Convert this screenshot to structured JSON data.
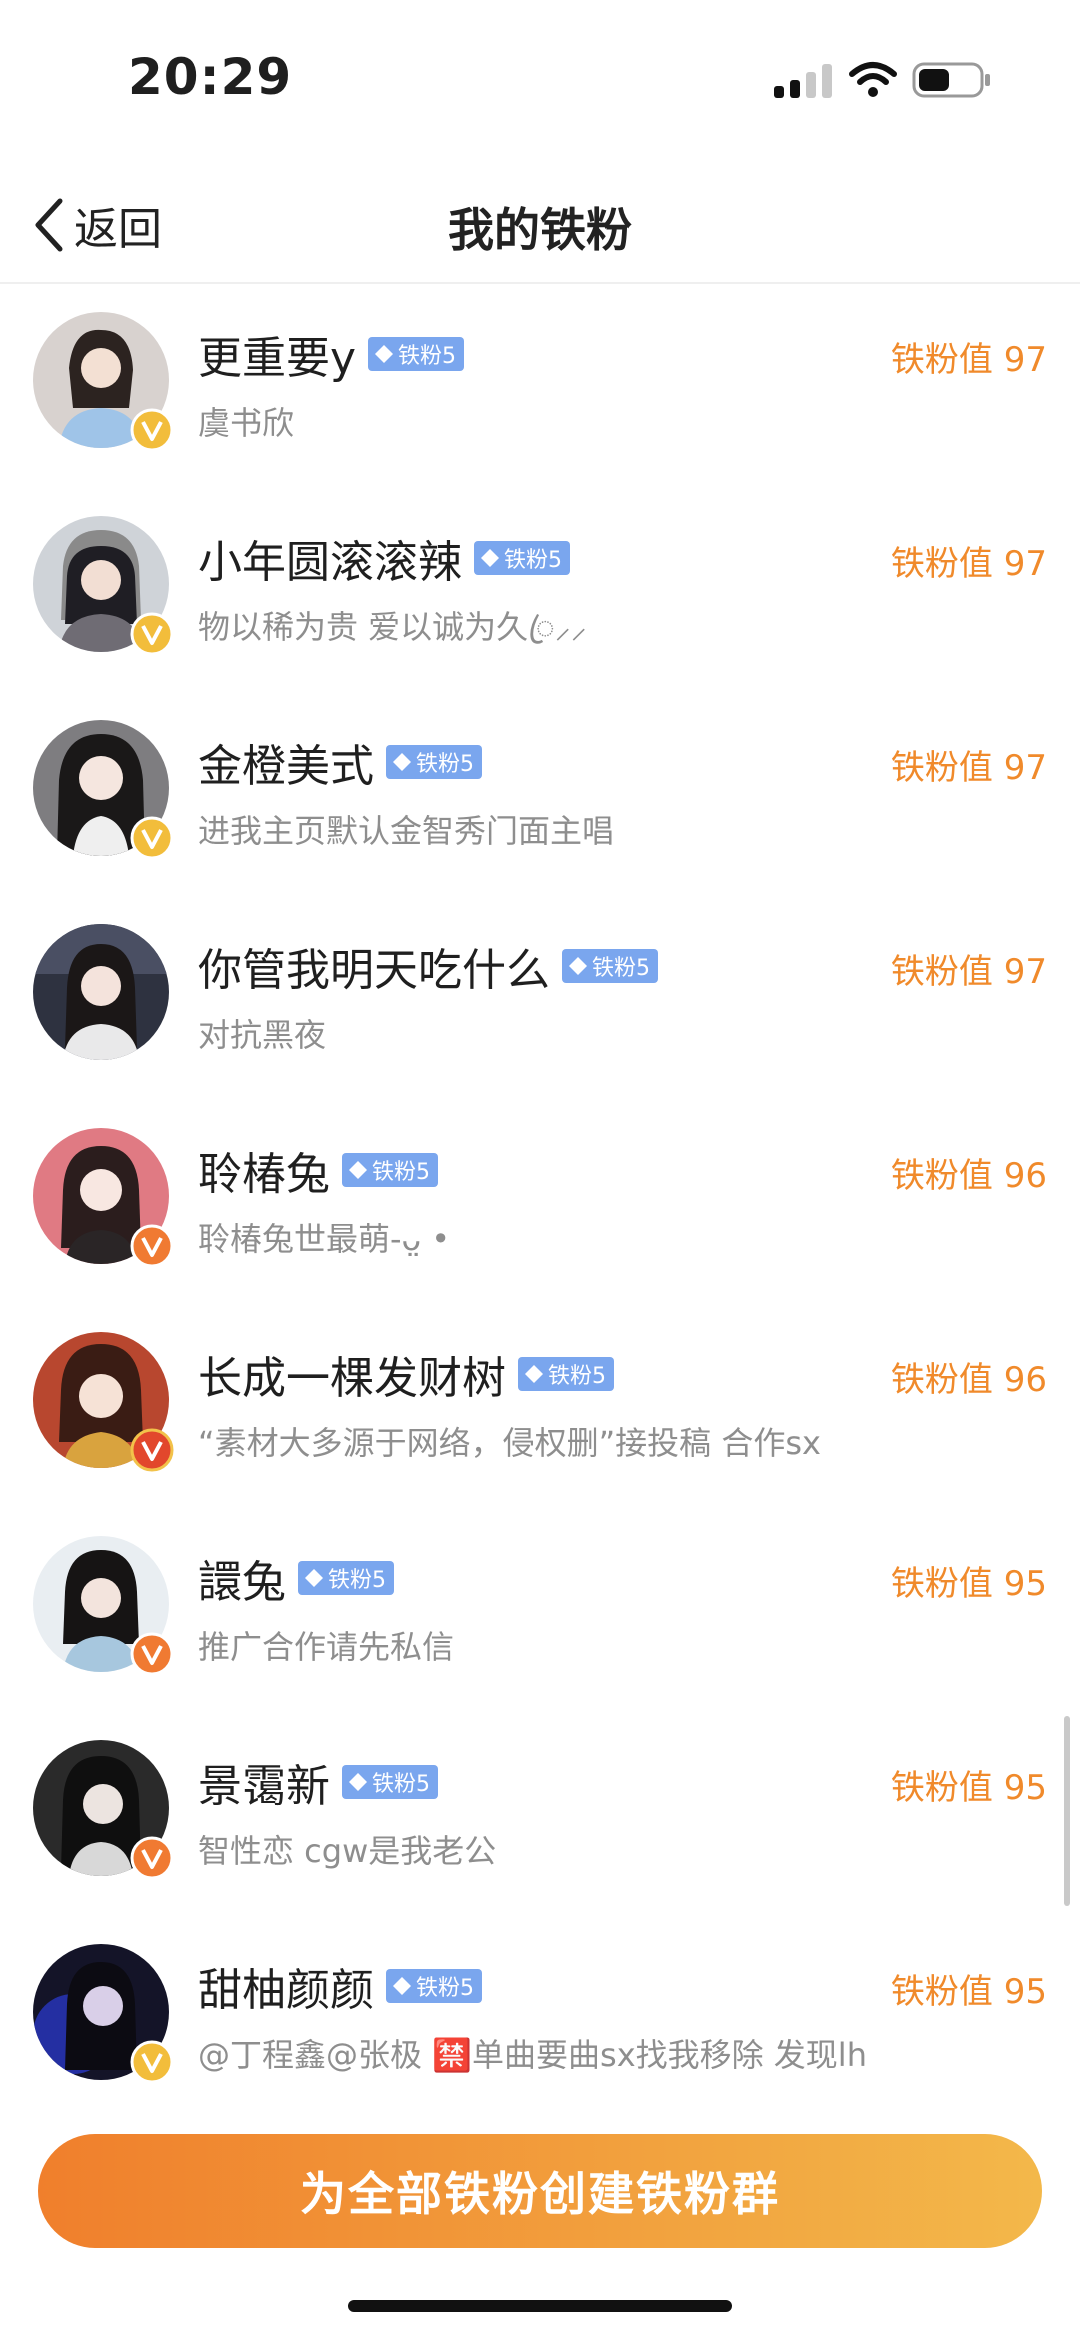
{
  "status_bar": {
    "time": "20:29"
  },
  "nav": {
    "back_label": "返回",
    "title": "我的铁粉"
  },
  "colors": {
    "accent": "#f08a2b",
    "fan_tag": "#7aa6ee",
    "badge_gold": "#f2bd3b",
    "badge_orange": "#f07a32",
    "badge_red": "#e2472c"
  },
  "fans": [
    {
      "name": "更重要y",
      "tag": "铁粉5",
      "score": "铁粉值 97",
      "bio": "虞书欣",
      "badge": "gold",
      "badge_icon": "v-verified-icon"
    },
    {
      "name": "小年圆滚滚辣",
      "tag": "铁粉5",
      "score": "铁粉值 97",
      "bio": "物以稀为贵 爱以诚为久ꦿ⸝⸝ ",
      "badge": "gold",
      "badge_icon": "v-verified-icon"
    },
    {
      "name": "金橙美式",
      "tag": "铁粉5",
      "score": "铁粉值 97",
      "bio": "进我主页默认金智秀门面主唱",
      "badge": "gold",
      "badge_icon": "v-verified-icon"
    },
    {
      "name": "你管我明天吃什么",
      "tag": "铁粉5",
      "score": "铁粉值 97",
      "bio": "对抗黑夜",
      "badge": "none",
      "badge_icon": ""
    },
    {
      "name": "聆椿兔",
      "tag": "铁粉5",
      "score": "铁粉值 96",
      "bio": "聆椿兔世最萌-ᴗ̤ •",
      "badge": "orange",
      "badge_icon": "v-verified-icon"
    },
    {
      "name": "长成一棵发财树",
      "tag": "铁粉5",
      "score": "铁粉值 96",
      "bio": "“素材大多源于网络，侵权删”接投稿 合作sx",
      "badge": "red",
      "badge_icon": "v-verified-icon"
    },
    {
      "name": "譞兔",
      "tag": "铁粉5",
      "score": "铁粉值 95",
      "bio": "推广合作请先私信",
      "badge": "orange",
      "badge_icon": "v-verified-icon"
    },
    {
      "name": "景霭新",
      "tag": "铁粉5",
      "score": "铁粉值 95",
      "bio": "智性恋 cgw是我老公",
      "badge": "orange",
      "badge_icon": "v-verified-icon"
    },
    {
      "name": "甜柚颜颜",
      "tag": "铁粉5",
      "score": "铁粉值 95",
      "bio": "@丁程鑫@张极 🈲单曲要曲sx找我移除 发现lh",
      "badge": "gold",
      "badge_icon": "v-verified-icon"
    }
  ],
  "cta": {
    "label": "为全部铁粉创建铁粉群"
  }
}
